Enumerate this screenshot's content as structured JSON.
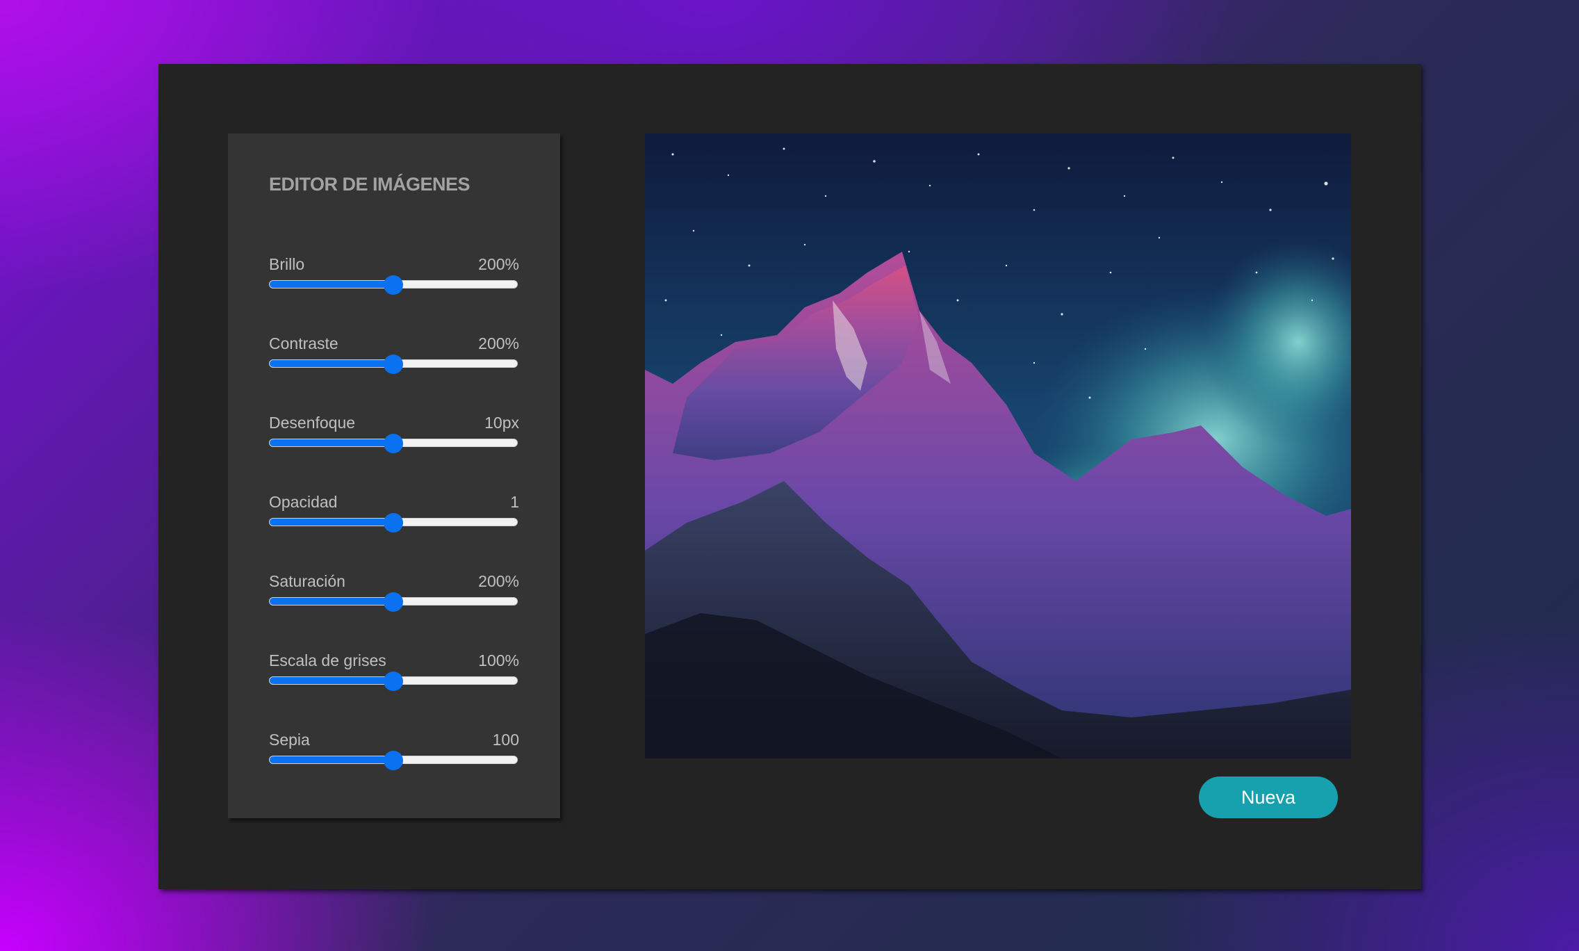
{
  "editor": {
    "title": "EDITOR DE IMÁGENES",
    "controls": [
      {
        "label": "Brillo",
        "value": "200%",
        "level": 0.5
      },
      {
        "label": "Contraste",
        "value": "200%",
        "level": 0.5
      },
      {
        "label": "Desenfoque",
        "value": "10px",
        "level": 0.5
      },
      {
        "label": "Opacidad",
        "value": "1",
        "level": 0.5
      },
      {
        "label": "Saturación",
        "value": "200%",
        "level": 0.5
      },
      {
        "label": "Escala de grises",
        "value": "100%",
        "level": 0.5
      },
      {
        "label": "Sepia",
        "value": "100",
        "level": 0.5
      }
    ]
  },
  "actions": {
    "new_label": "Nueva"
  },
  "colors": {
    "slider_accent": "#0a72f0",
    "button_accent": "#17a1ae",
    "panel_background": "#232323",
    "editor_background": "#343434"
  }
}
